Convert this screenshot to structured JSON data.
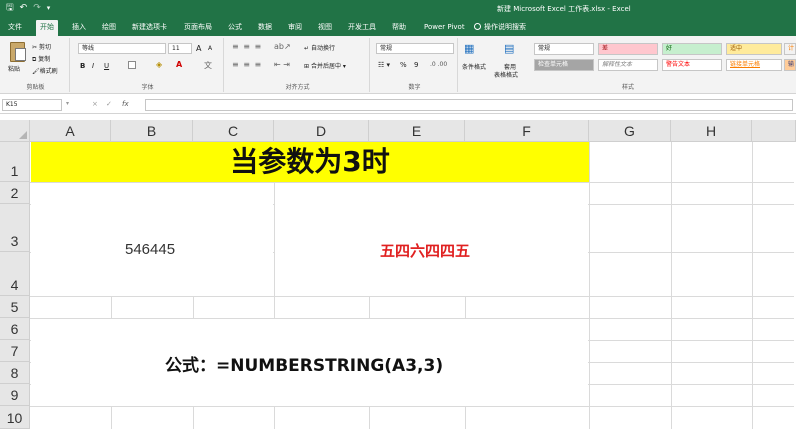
{
  "window": {
    "title": "新建 Microsoft Excel 工作表.xlsx  -  Excel"
  },
  "quick_access": {
    "save_icon": "save-icon",
    "undo_icon": "undo-icon",
    "redo_icon": "redo-icon"
  },
  "tabs": [
    "文件",
    "开始",
    "插入",
    "绘图",
    "新建选项卡",
    "页面布局",
    "公式",
    "数据",
    "审阅",
    "视图",
    "开发工具",
    "帮助",
    "Power Pivot",
    "操作说明搜索"
  ],
  "active_tab": "开始",
  "ribbon": {
    "clipboard": {
      "paste": "粘贴",
      "cut": "剪切",
      "copy": "复制",
      "format_painter": "格式刷",
      "label": "剪贴板"
    },
    "font": {
      "font_name": "等线",
      "font_size": "11",
      "grow": "A",
      "shrink": "A",
      "bold": "B",
      "italic": "I",
      "underline": "U",
      "label": "字体"
    },
    "alignment": {
      "wrap_text": "自动换行",
      "merge_center": "合并后居中",
      "label": "对齐方式"
    },
    "number": {
      "format": "常规",
      "percent": "%",
      "comma": "9",
      "label": "数字"
    },
    "styles": {
      "conditional": "条件格式",
      "table_format_1": "套用",
      "table_format_2": "表格格式",
      "cells": [
        {
          "label": "常规",
          "bg": "#ffffff",
          "fg": "#222222"
        },
        {
          "label": "差",
          "bg": "#ffc7ce",
          "fg": "#9c0006"
        },
        {
          "label": "好",
          "bg": "#c6efce",
          "fg": "#006100"
        },
        {
          "label": "适中",
          "bg": "#ffeb9c",
          "fg": "#9c5700"
        },
        {
          "label": "计",
          "bg": "#f2f2f2",
          "fg": "#fa7d00"
        },
        {
          "label": "检查单元格",
          "bg": "#a5a5a5",
          "fg": "#ffffff"
        },
        {
          "label": "解释性文本",
          "bg": "#ffffff",
          "fg": "#7f7f7f"
        },
        {
          "label": "警告文本",
          "bg": "#ffffff",
          "fg": "#ff0000"
        },
        {
          "label": "链接单元格",
          "bg": "#ffffff",
          "fg": "#fa7d00"
        },
        {
          "label": "输",
          "bg": "#ffcc99",
          "fg": "#3f3f76"
        }
      ],
      "label": "样式"
    }
  },
  "formula_bar": {
    "name_box": "K15",
    "cancel": "×",
    "enter": "✓",
    "fx": "fx",
    "content": ""
  },
  "sheet": {
    "columns": [
      "A",
      "B",
      "C",
      "D",
      "E",
      "F",
      "G",
      "H"
    ],
    "rows": [
      "1",
      "2",
      "3",
      "4",
      "5",
      "6",
      "7",
      "8",
      "9",
      "10"
    ],
    "banner_text": "当参数为3时",
    "banner_color": "#ffff00",
    "value_a3": "546445",
    "result_text": "五四六四四五",
    "result_color": "#e02020",
    "formula_text": "公式：=NUMBERSTRING(A3,3)"
  }
}
